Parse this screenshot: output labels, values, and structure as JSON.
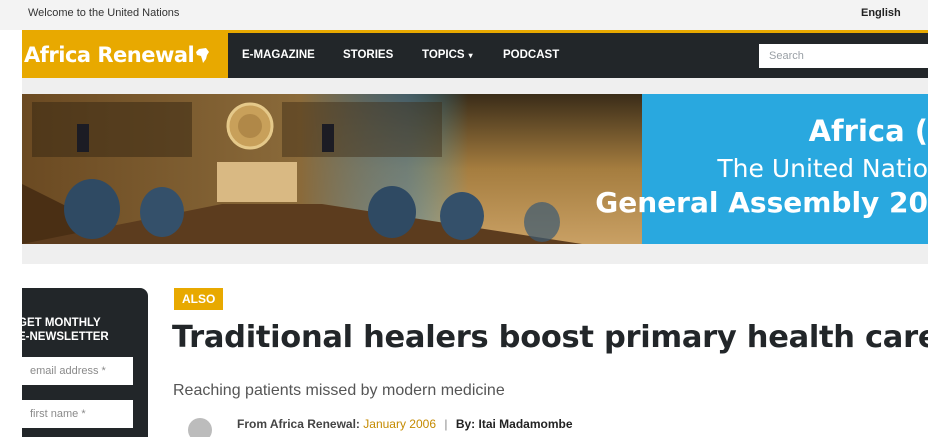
{
  "topbar": {
    "welcome": "Welcome to the United Nations",
    "language": "English"
  },
  "nav": {
    "logo": "Africa Renewal",
    "items": [
      {
        "label": "E-MAGAZINE"
      },
      {
        "label": "STORIES"
      },
      {
        "label": "TOPICS",
        "caret": "▾"
      },
      {
        "label": "PODCAST"
      }
    ],
    "search_placeholder": "Search"
  },
  "banner": {
    "line1": "Africa (",
    "line2": "The United Natio",
    "line3": "General Assembly 20"
  },
  "newsletter": {
    "title": "GET MONTHLY\nE-NEWSLETTER",
    "email_placeholder": "email address *",
    "firstname_placeholder": "first name *"
  },
  "article": {
    "badge": "ALSO",
    "headline": "Traditional healers boost primary health care",
    "subtitle": "Reaching patients missed by modern medicine",
    "byline": {
      "from_label": "From Africa Renewal:",
      "issue": "January 2006",
      "separator": "|",
      "by_label": "By:",
      "author": "Itai Madamombe"
    }
  },
  "colors": {
    "accent": "#e8a900",
    "dark": "#222629",
    "banner_blue": "#29a8df"
  }
}
